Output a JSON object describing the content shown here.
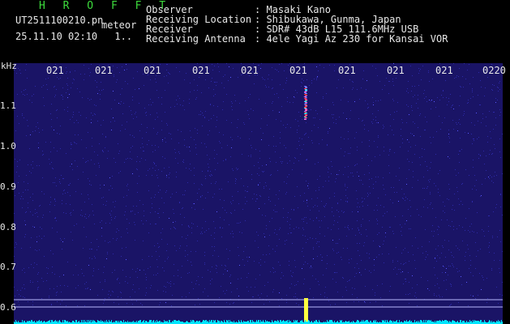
{
  "header": {
    "brand": "H R O F F T",
    "filename": "UT2511100210.pn",
    "type_tag": "meteor",
    "datetime": "25.11.10 02:10",
    "extra": "1..",
    "info": [
      {
        "label": "Observer",
        "value": ": Masaki Kano"
      },
      {
        "label": "Receiving Location",
        "value": ": Shibukawa, Gunma, Japan"
      },
      {
        "label": "Receiver",
        "value": ": SDR# 43dB L15 111.6MHz USB"
      },
      {
        "label": "Receiving Antenna",
        "value": ": 4ele Yagi Az 230 for Kansai VOR"
      }
    ]
  },
  "axis": {
    "unit": "kHz",
    "time_ticks": [
      "021",
      "021",
      "021",
      "021",
      "021",
      "021",
      "021",
      "021",
      "021",
      "0220"
    ],
    "freq_ticks": [
      "1.1",
      "1.0",
      "0.9",
      "0.8",
      "0.7",
      "0.6"
    ]
  },
  "colors": {
    "background": "#1a1466",
    "noise": "#2d2aa8",
    "echo_red": "#ff3030",
    "echo_yellow": "#ffff40",
    "baseline": "#00e5ff",
    "grid_line": "#b8b8ff"
  }
}
